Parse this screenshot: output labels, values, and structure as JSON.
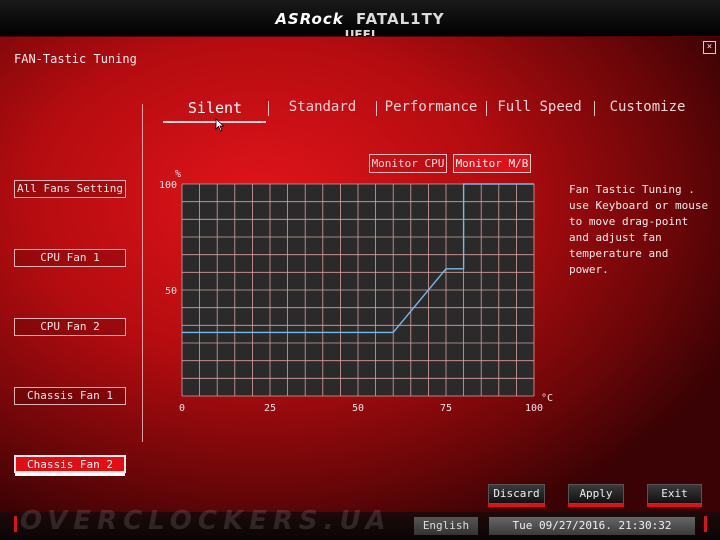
{
  "header": {
    "brand_asrock": "ASRock",
    "brand_fatality": "FATAL1TY",
    "brand_uefi": "UEFI"
  },
  "page_title": "FAN-Tastic Tuning",
  "sidebar": {
    "items": [
      {
        "label": "All Fans Setting",
        "active": false
      },
      {
        "label": "CPU Fan 1",
        "active": false
      },
      {
        "label": "CPU Fan 2",
        "active": false
      },
      {
        "label": "Chassis Fan 1",
        "active": false
      },
      {
        "label": "Chassis Fan 2",
        "active": true
      }
    ]
  },
  "tabs": [
    {
      "label": "Silent",
      "active": true
    },
    {
      "label": "Standard",
      "active": false
    },
    {
      "label": "Performance",
      "active": false
    },
    {
      "label": "Full Speed",
      "active": false
    },
    {
      "label": "Customize",
      "active": false
    }
  ],
  "monitor": {
    "cpu_label": "Monitor CPU",
    "mb_label": "Monitor M/B",
    "selected": "Monitor M/B"
  },
  "chart_data": {
    "type": "line",
    "title": "",
    "xlabel": "°C",
    "ylabel": "%",
    "xlim": [
      0,
      100
    ],
    "ylim": [
      0,
      100
    ],
    "x_ticks": [
      "0",
      "25",
      "50",
      "75",
      "100"
    ],
    "y_ticks": [
      "50",
      "100"
    ],
    "grid": true,
    "series": [
      {
        "x": [
          0,
          60,
          75,
          80,
          80,
          100
        ],
        "y": [
          30,
          30,
          60,
          60,
          100,
          100
        ]
      }
    ]
  },
  "help_text": "Fan Tastic Tuning . use Keyboard or mouse to move drag-point and adjust fan temperature and power.",
  "buttons": {
    "discard": "Discard",
    "apply": "Apply",
    "exit": "Exit"
  },
  "footer": {
    "language": "English",
    "datetime": "Tue 09/27/2016. 21:30:32",
    "watermark": "OVERCLOCKERS.UA"
  },
  "colors": {
    "accent": "#e01018",
    "chart_bg": "#2a2a2a",
    "grid": "#d8a0a0",
    "line": "#7ab8e8"
  }
}
